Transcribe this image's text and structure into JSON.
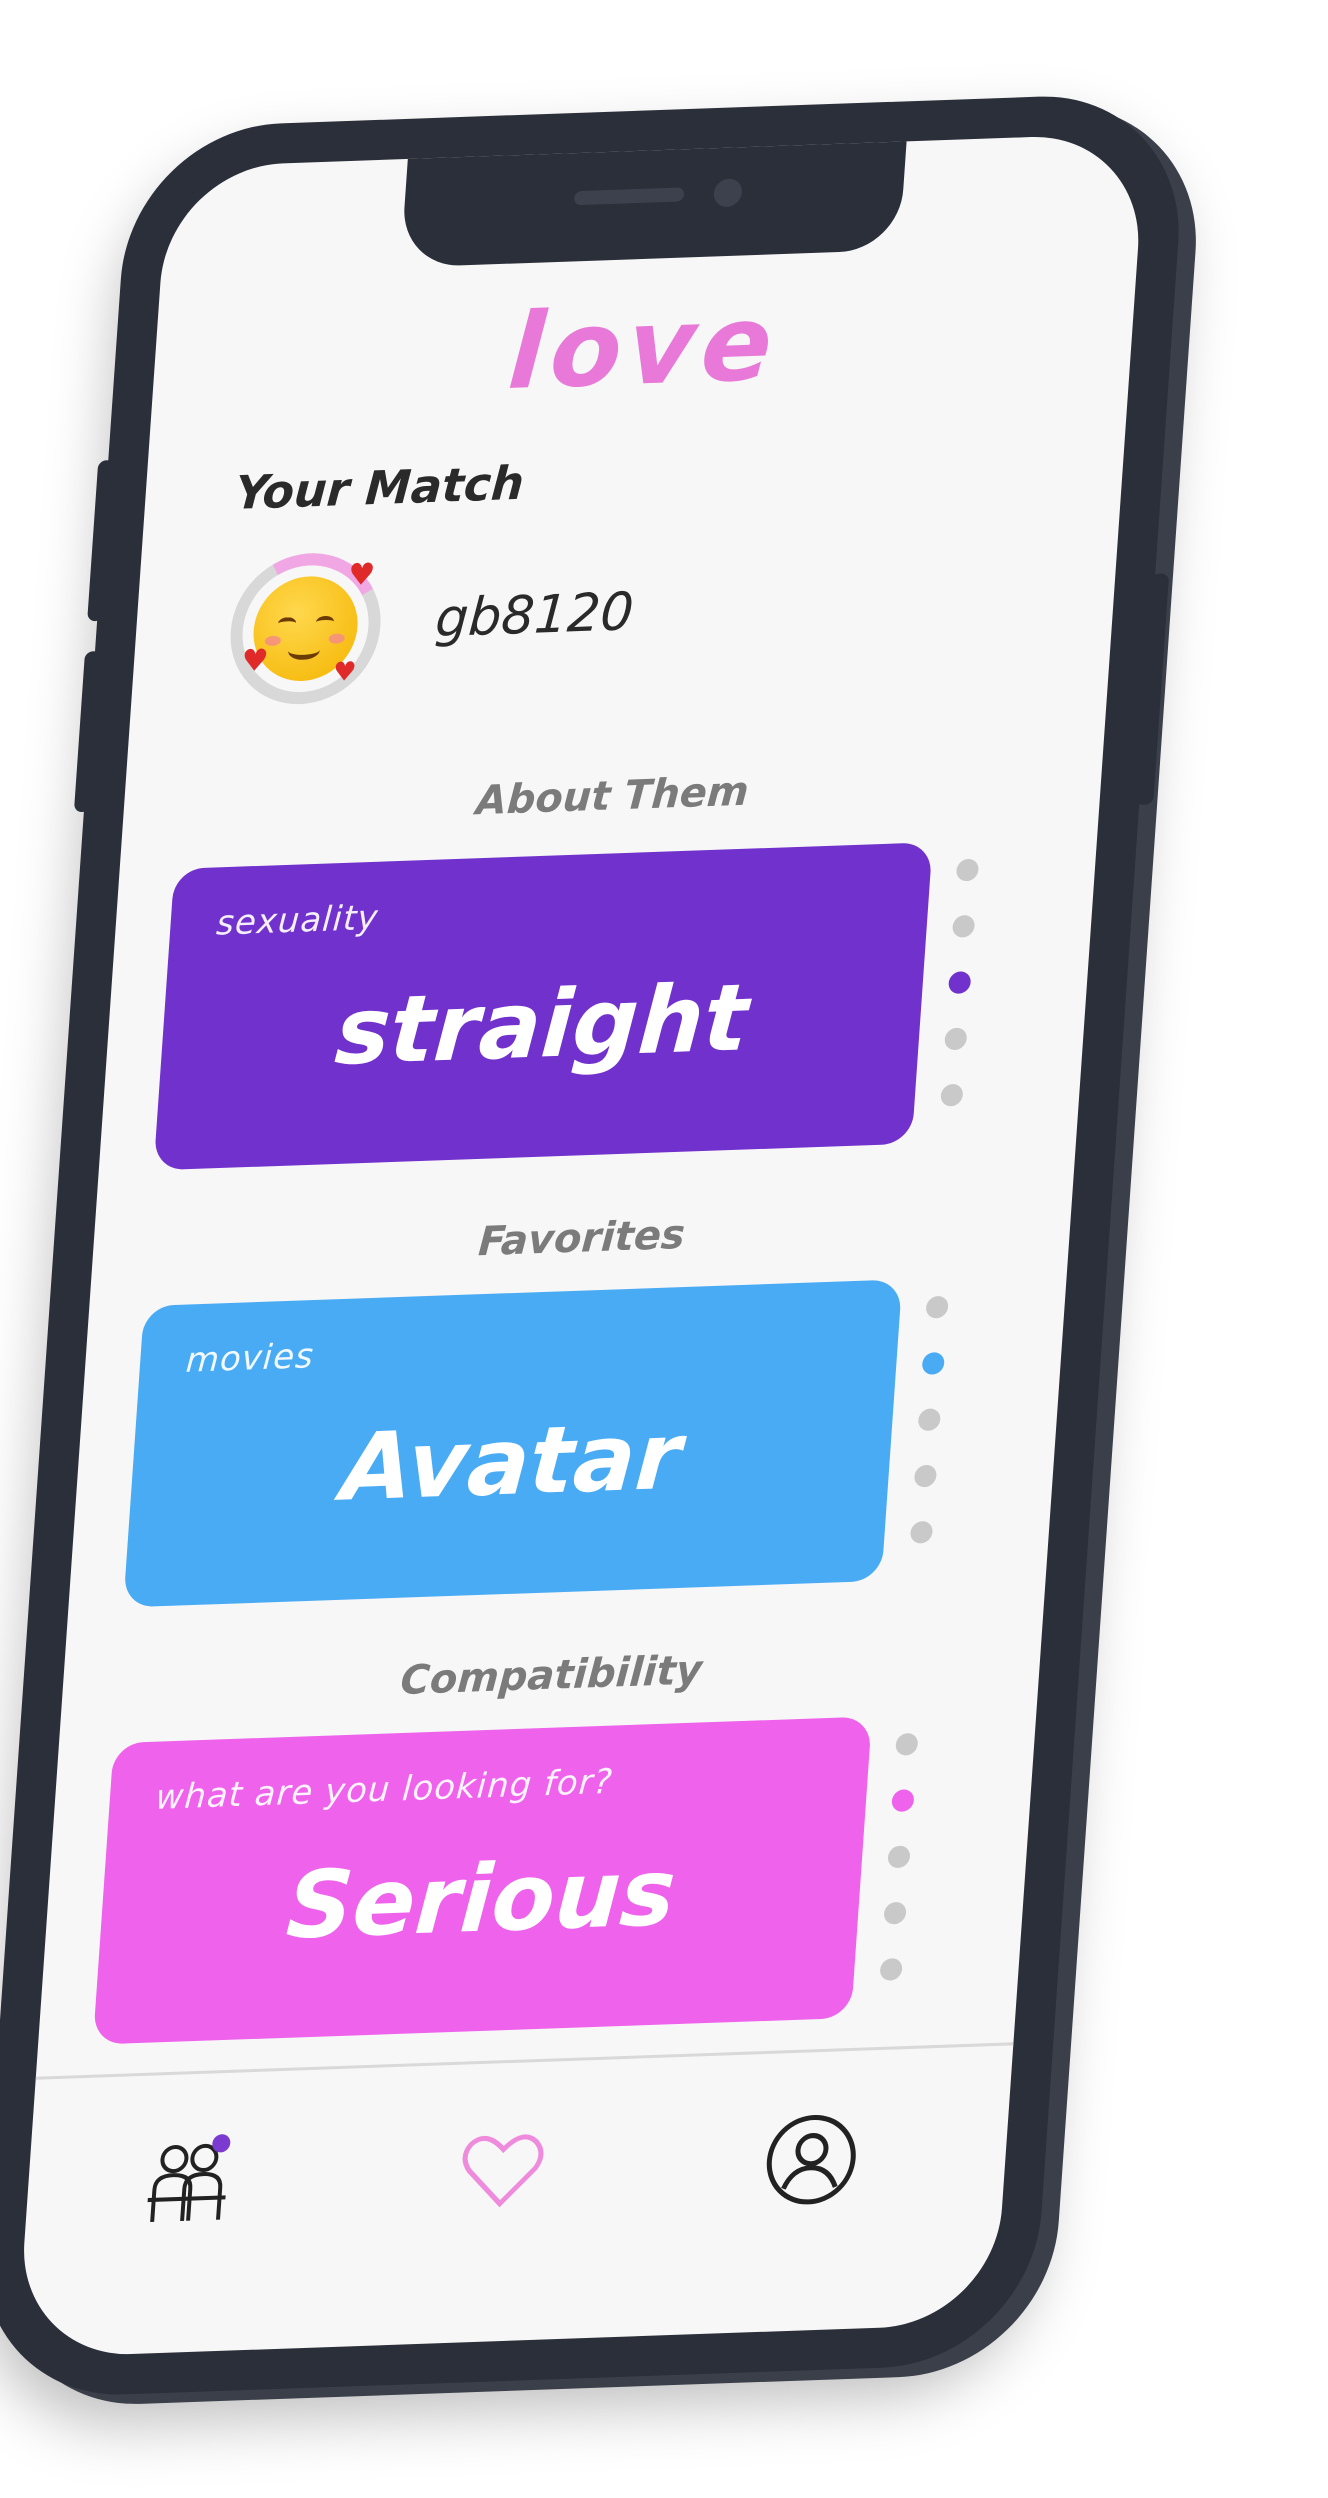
{
  "app": {
    "logo_text": "love"
  },
  "match": {
    "title": "Your Match",
    "username": "gb8120",
    "avatar_icon": "smiling-face-with-hearts-icon"
  },
  "sections": [
    {
      "label": "About Them",
      "card": {
        "caption": "sexuality",
        "value": "straight",
        "color": "#7131cc"
      },
      "dots": {
        "count": 5,
        "active_index": 2,
        "active_color": "#7131cc"
      }
    },
    {
      "label": "Favorites",
      "card": {
        "caption": "movies",
        "value": "Avatar",
        "color": "#4aabf5"
      },
      "dots": {
        "count": 5,
        "active_index": 1,
        "active_color": "#4aabf5"
      }
    },
    {
      "label": "Compatibility",
      "card": {
        "caption": "what are you looking for?",
        "value": "Serious",
        "color": "#ee62ec"
      },
      "dots": {
        "count": 5,
        "active_index": 1,
        "active_color": "#ee62ec"
      }
    }
  ],
  "nav": {
    "items": [
      {
        "icon": "people-icon",
        "badge_color": "#7b3bd0"
      },
      {
        "icon": "heart-icon",
        "active_color": "#ef8bdc"
      },
      {
        "icon": "profile-icon"
      }
    ]
  }
}
